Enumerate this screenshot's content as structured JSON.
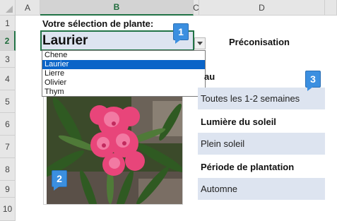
{
  "sheet": {
    "columns": [
      "A",
      "B",
      "C",
      "D"
    ],
    "rows": [
      "1",
      "2",
      "3",
      "4",
      "5",
      "6",
      "7",
      "8",
      "9",
      "10"
    ]
  },
  "title": "Votre sélection de plante:",
  "selected_value": "Laurier",
  "dropdown": {
    "options": [
      "Chene",
      "Laurier",
      "Lierre",
      "Olivier",
      "Thym"
    ],
    "selected_index": 1
  },
  "preconisation": {
    "header": "Préconisation",
    "water_label": "au",
    "water_value": "Toutes les 1-2 semaines",
    "sun_label": "Lumière du soleil",
    "sun_value": "Plein soleil",
    "planting_label": "Période de plantation",
    "planting_value": "Automne"
  },
  "callouts": [
    "1",
    "2",
    "3"
  ],
  "colors": {
    "selection_green": "#217346",
    "cell_fill": "#dde4f0",
    "list_highlight": "#0a64c8",
    "callout_blue": "#3b8fe0"
  }
}
